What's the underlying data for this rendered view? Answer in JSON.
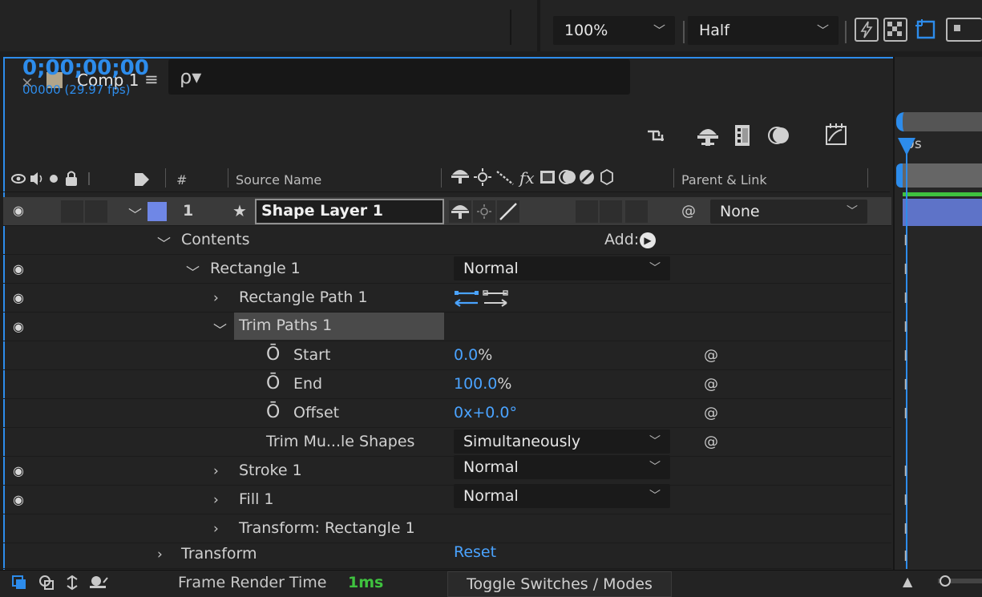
{
  "viewer": {
    "zoom": "100%",
    "resolution": "Half"
  },
  "comp_tab": {
    "name": "Comp 1",
    "close_glyph": "×",
    "menu_glyph": "≡",
    "label_color": "#b2a58a"
  },
  "timecode": {
    "time": "0;00;00;00",
    "frames": "00000 (29.97 fps)",
    "search_glyph": "ρ▾"
  },
  "columns": {
    "number": "#",
    "source_name": "Source Name",
    "parent_link": "Parent & Link"
  },
  "layer": {
    "number": "1",
    "name": "Shape Layer 1",
    "color": "#6f87e6",
    "parent": "None"
  },
  "rows": {
    "contents": "Contents",
    "add": "Add:",
    "rectangle": "Rectangle 1",
    "rectangle_mode": "Normal",
    "rectangle_path": "Rectangle Path 1",
    "trim_paths": "Trim Paths 1",
    "start_label": "Start",
    "start_value": "0.0",
    "start_unit": "%",
    "end_label": "End",
    "end_value": "100.0",
    "end_unit": "%",
    "offset_label": "Offset",
    "offset_value": "0x+0.0°",
    "trim_multiple_label": "Trim Mu...le Shapes",
    "trim_multiple_value": "Simultaneously",
    "stroke": "Stroke 1",
    "stroke_mode": "Normal",
    "fill": "Fill 1",
    "fill_mode": "Normal",
    "transform_rect": "Transform: Rectangle 1",
    "transform": "Transform",
    "transform_reset": "Reset"
  },
  "timeline": {
    "ruler_label": "0s",
    "playhead_color": "#2d8ceb",
    "work_area_color": "#3fc23f"
  },
  "bottom_bar": {
    "render_label": "Frame Render Time",
    "render_value": "1ms",
    "toggle_label": "Toggle Switches / Modes"
  }
}
